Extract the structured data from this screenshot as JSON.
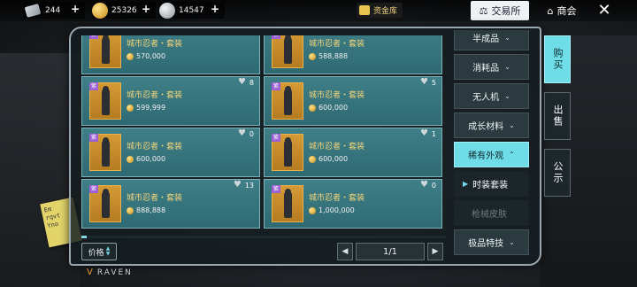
{
  "currencies": [
    {
      "name": "ticket-icon",
      "value": "244"
    },
    {
      "name": "gold-coin-icon",
      "value": "25326"
    },
    {
      "name": "silver-coin-icon",
      "value": "14547"
    }
  ],
  "topbar": {
    "plus": "+",
    "vault_label": "资金库",
    "tab_exchange": "交易所",
    "tab_shop": "商会",
    "close": "✕"
  },
  "items": [
    {
      "name": "城市忍者・套装",
      "price": "570,000",
      "likes": "23"
    },
    {
      "name": "城市忍者・套装",
      "price": "588,888",
      "likes": "19"
    },
    {
      "name": "城市忍者・套装",
      "price": "599,999",
      "likes": "8"
    },
    {
      "name": "城市忍者・套装",
      "price": "600,000",
      "likes": "5"
    },
    {
      "name": "城市忍者・套装",
      "price": "600,000",
      "likes": "0"
    },
    {
      "name": "城市忍者・套装",
      "price": "600,000",
      "likes": "1"
    },
    {
      "name": "城市忍者・套装",
      "price": "888,888",
      "likes": "13"
    },
    {
      "name": "城市忍者・套装",
      "price": "1,000,000",
      "likes": "0"
    }
  ],
  "rarity_tag": "紫",
  "categories": [
    {
      "label": "半成品",
      "active": false
    },
    {
      "label": "消耗品",
      "active": false
    },
    {
      "label": "无人机",
      "active": false
    },
    {
      "label": "成长材料",
      "active": false
    },
    {
      "label": "稀有外观",
      "active": true
    }
  ],
  "subcategories": [
    {
      "label": "时装套装",
      "selected": true
    },
    {
      "label": "枪械皮肤",
      "selected": false
    }
  ],
  "category_bottom": "极品特技",
  "side_tabs": {
    "buy": "购买",
    "sell": "出售",
    "notice": "公示"
  },
  "sort_label": "价格",
  "pager": {
    "text": "1/1",
    "prev": "◀",
    "next": "▶"
  },
  "brand": "RAVEN",
  "sticky_note": "Em\nrqvt\nYno"
}
